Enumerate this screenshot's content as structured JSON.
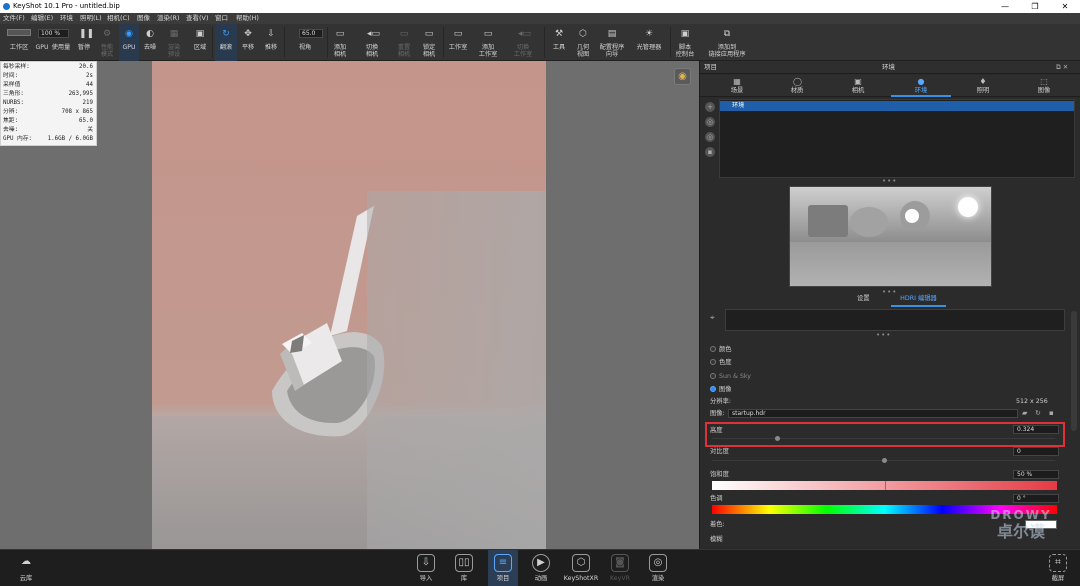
{
  "window": {
    "title": "KeyShot 10.1 Pro  - untitled.bip",
    "minimize": "—",
    "maximize": "❐",
    "close": "✕"
  },
  "menu": [
    "文件(F)",
    "编辑(E)",
    "环境",
    "照明(L)",
    "相机(C)",
    "图像",
    "渲染(R)",
    "查看(V)",
    "窗口",
    "帮助(H)"
  ],
  "toolbar": {
    "items": [
      {
        "label": "工作区",
        "icon": "workspace-icon"
      },
      {
        "label": "GPU",
        "icon": "gpu-icon"
      },
      {
        "label": "使用量",
        "icon": "usage-icon"
      },
      {
        "label": "暂停",
        "icon": "pause-icon"
      },
      {
        "label": "性能",
        "label2": "模式",
        "icon": "performance-icon"
      },
      {
        "label": "GPU",
        "icon": "gpu-mode-icon"
      },
      {
        "label": "去噪",
        "icon": "denoise-icon"
      },
      {
        "label": "渲染",
        "label2": "预设",
        "icon": "render-preset-icon"
      },
      {
        "label": "区域",
        "icon": "region-icon"
      },
      {
        "label": "翻滚",
        "icon": "tumble-icon"
      },
      {
        "label": "平移",
        "icon": "pan-icon"
      },
      {
        "label": "推移",
        "icon": "dolly-icon"
      },
      {
        "label": "视角",
        "icon": "perspective-icon"
      },
      {
        "label": "添加",
        "label2": "相机",
        "icon": "add-camera-icon"
      },
      {
        "label": "切换",
        "label2": "相机",
        "icon": "switch-camera-icon"
      },
      {
        "label": "重置",
        "label2": "相机",
        "icon": "reset-camera-icon"
      },
      {
        "label": "锁定",
        "label2": "相机",
        "icon": "lock-camera-icon"
      },
      {
        "label": "工作室",
        "icon": "studio-icon"
      },
      {
        "label": "添加",
        "label2": "工作室",
        "icon": "add-studio-icon"
      },
      {
        "label": "切换",
        "label2": "工作室",
        "icon": "switch-studio-icon"
      },
      {
        "label": "工具",
        "icon": "tools-icon"
      },
      {
        "label": "几何",
        "label2": "视图",
        "icon": "geometry-view-icon"
      },
      {
        "label": "配置程序",
        "label2": "向导",
        "icon": "configurator-icon"
      },
      {
        "label": "光管理器",
        "icon": "light-manager-icon"
      },
      {
        "label": "脚本",
        "label2": "控制台",
        "icon": "script-console-icon"
      },
      {
        "label": "添加到",
        "label2": "链接应用程序",
        "icon": "link-app-icon"
      }
    ],
    "resolution_value": "100 %",
    "fov_value": "65.0"
  },
  "stats": [
    {
      "k": "每秒采样:",
      "v": "20.6"
    },
    {
      "k": "时间:",
      "v": "2s"
    },
    {
      "k": "采样值",
      "v": "44"
    },
    {
      "k": "三角形:",
      "v": "263,995"
    },
    {
      "k": "NURBS:",
      "v": "219"
    },
    {
      "k": "分辨:",
      "v": "708 x 865"
    },
    {
      "k": "焦距:",
      "v": "65.0"
    },
    {
      "k": "去噪:",
      "v": "关"
    },
    {
      "k": "GPU 内存:",
      "v": "1.6GB / 6.0GB"
    }
  ],
  "panel": {
    "header_left": "项目",
    "header_title": "环境",
    "header_icons": "⧉ ✕",
    "tabs": [
      {
        "label": "场景",
        "icon": "scene-icon"
      },
      {
        "label": "材质",
        "icon": "material-icon"
      },
      {
        "label": "相机",
        "icon": "camera-icon"
      },
      {
        "label": "环境",
        "icon": "environment-icon"
      },
      {
        "label": "照明",
        "icon": "lighting-icon"
      },
      {
        "label": "图像",
        "icon": "image-icon"
      }
    ],
    "env_item": "环境",
    "dots": "•••",
    "subtab_settings": "设置",
    "subtab_hdri": "HDRI 编辑器",
    "radios": [
      "颜色",
      "色度",
      "Sun & Sky",
      "图像"
    ],
    "resolution_label": "分辨率:",
    "resolution_value": "512 x 256",
    "image_label": "图像:",
    "image_value": "startup.hdr",
    "brightness_label": "高度",
    "brightness_value": "0.324",
    "contrast_label": "对比度",
    "contrast_value": "0",
    "saturation_label": "饱和度",
    "saturation_value": "50 %",
    "hue_label": "色调",
    "hue_value": "0 °",
    "tint_label": "着色:",
    "blur_label": "模糊",
    "brightness_level": 0.19,
    "contrast_level": 0.5,
    "saturation_level": 0.5
  },
  "bottom": {
    "items": [
      {
        "label": "云库",
        "icon": "cloud-library-icon"
      },
      {
        "label": "导入",
        "icon": "import-icon"
      },
      {
        "label": "库",
        "icon": "library-icon"
      },
      {
        "label": "项目",
        "icon": "project-icon"
      },
      {
        "label": "动画",
        "icon": "animation-icon"
      },
      {
        "label": "KeyShotXR",
        "icon": "keyshotxr-icon"
      },
      {
        "label": "KeyVR",
        "icon": "keyvr-icon"
      },
      {
        "label": "渲染",
        "icon": "render-icon"
      },
      {
        "label": "截屏",
        "icon": "screenshot-icon"
      }
    ]
  },
  "watermark": {
    "line1": "DROWY",
    "line2": "卓尔谟"
  }
}
